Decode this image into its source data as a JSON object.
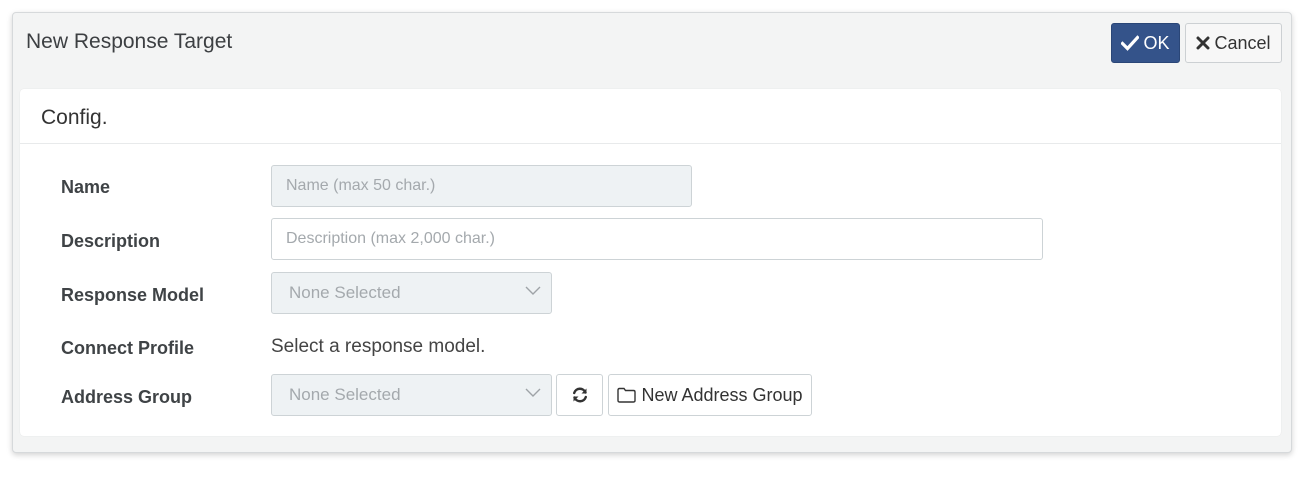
{
  "dialog": {
    "title": "New Response Target",
    "ok_label": "OK",
    "cancel_label": "Cancel",
    "accent_color": "#34538a"
  },
  "panel": {
    "title": "Config."
  },
  "form": {
    "name": {
      "label": "Name",
      "value": "",
      "placeholder": "Name (max 50 char.)"
    },
    "description": {
      "label": "Description",
      "value": "",
      "placeholder": "Description (max 2,000 char.)"
    },
    "response_model": {
      "label": "Response Model",
      "selected": "None Selected"
    },
    "connect_profile": {
      "label": "Connect Profile",
      "text": "Select a response model."
    },
    "address_group": {
      "label": "Address Group",
      "selected": "None Selected",
      "refresh_icon": "refresh-icon",
      "new_group_label": "New Address Group",
      "new_group_icon": "folder-icon"
    }
  }
}
